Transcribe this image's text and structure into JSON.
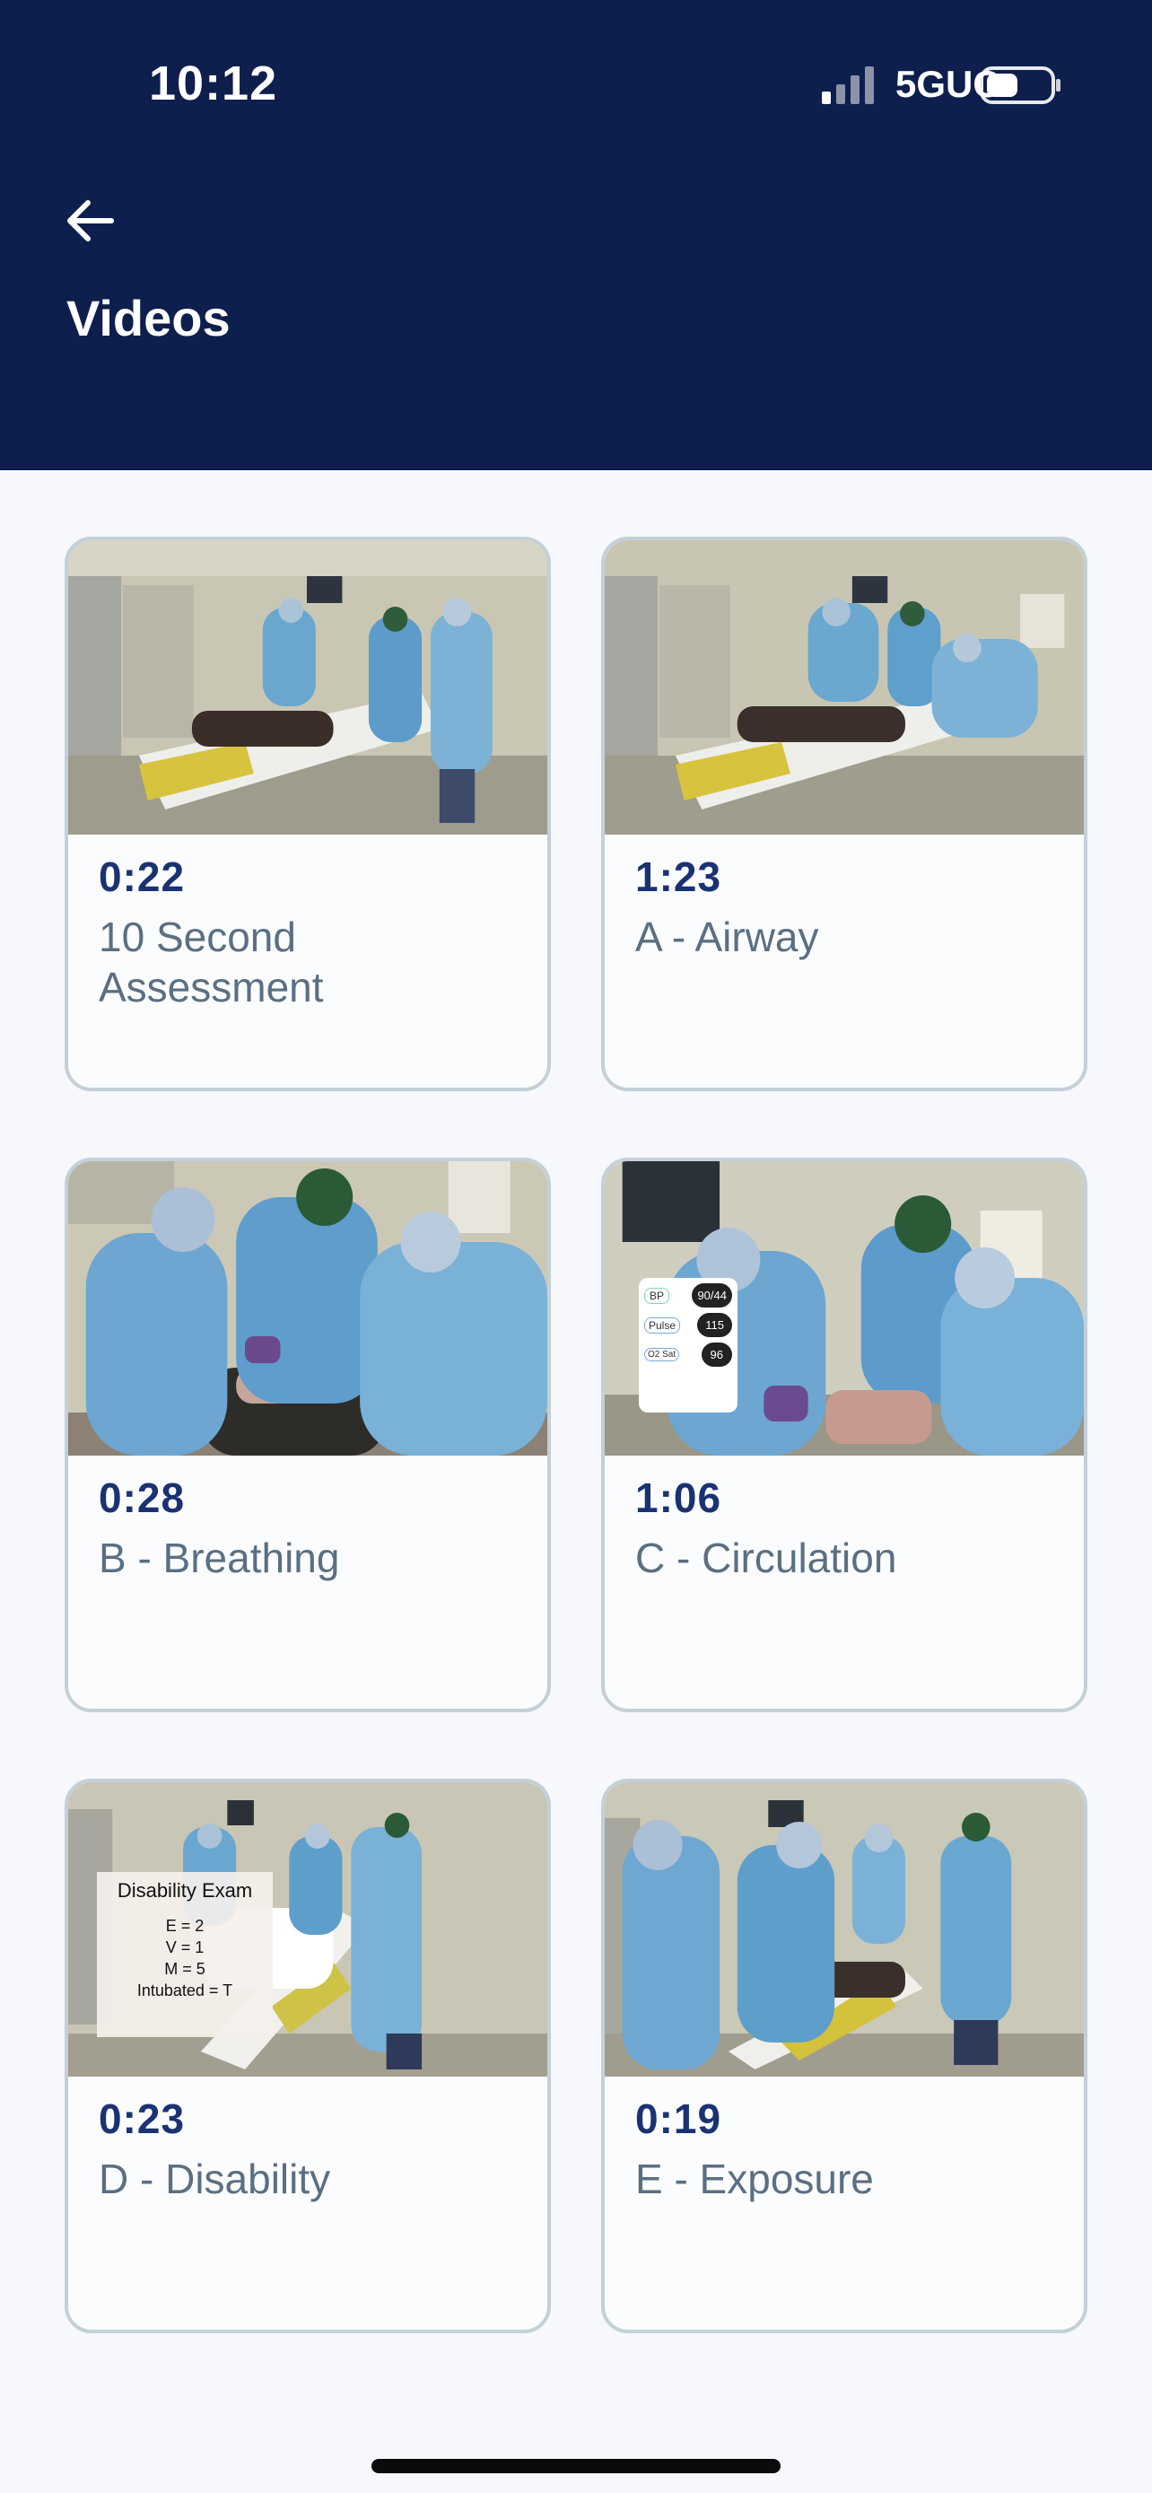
{
  "status_bar": {
    "time": "10:12",
    "network": "5GUC"
  },
  "header": {
    "title": "Videos"
  },
  "videos": [
    {
      "duration": "0:22",
      "title": "10 Second Assessment"
    },
    {
      "duration": "1:23",
      "title": "A - Airway"
    },
    {
      "duration": "0:28",
      "title": "B - Breathing"
    },
    {
      "duration": "1:06",
      "title": "C - Circulation",
      "overlay": {
        "bp_label": "BP",
        "bp_value": "90/44",
        "pulse_label": "Pulse",
        "pulse_value": "115",
        "o2_label": "O2 Sat",
        "o2_value": "96"
      }
    },
    {
      "duration": "0:23",
      "title": "D - Disability",
      "overlay": {
        "heading": "Disability Exam",
        "lines": [
          "E = 2",
          "V = 1",
          "M = 5",
          "Intubated = T"
        ]
      }
    },
    {
      "duration": "0:19",
      "title": "E - Exposure"
    }
  ],
  "colors": {
    "header_bg": "#0e1f4d",
    "duration": "#1b3272",
    "title": "#5b6f82",
    "card_border": "#c3d0d8"
  }
}
